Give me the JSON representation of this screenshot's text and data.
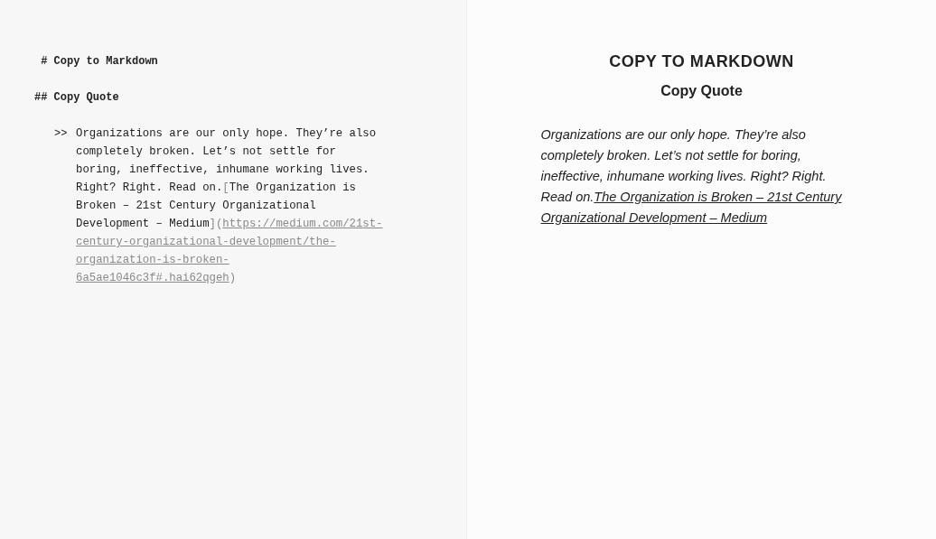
{
  "editor": {
    "heading_1": " # Copy to Markdown",
    "heading_2": "## Copy Quote",
    "quote": {
      "marker": ">>",
      "text": "Organizations are our only hope. They’re also completely broken. Let’s not settle for boring, ineffective, inhumane working lives. Right? Right. Read on.",
      "open_bracket": "[",
      "link_title": "The Organization is Broken – 21st Century Organizational Development – Medium",
      "middle": "](",
      "url": "https://medium.com/21st-century-organizational-development/the-organization-is-broken-6a5ae1046c3f#.hai62qgeh",
      "close": ")"
    }
  },
  "preview": {
    "title": "COPY TO MARKDOWN",
    "subtitle": "Copy Quote",
    "quote_text": "Organizations are our only hope. They’re also completely broken. Let’s not settle for boring, ineffective, inhumane working lives. Right? Right. Read on.",
    "link_lines": [
      "The Organization is Broken – 21st Century",
      "Organizational Development – Medium"
    ]
  }
}
